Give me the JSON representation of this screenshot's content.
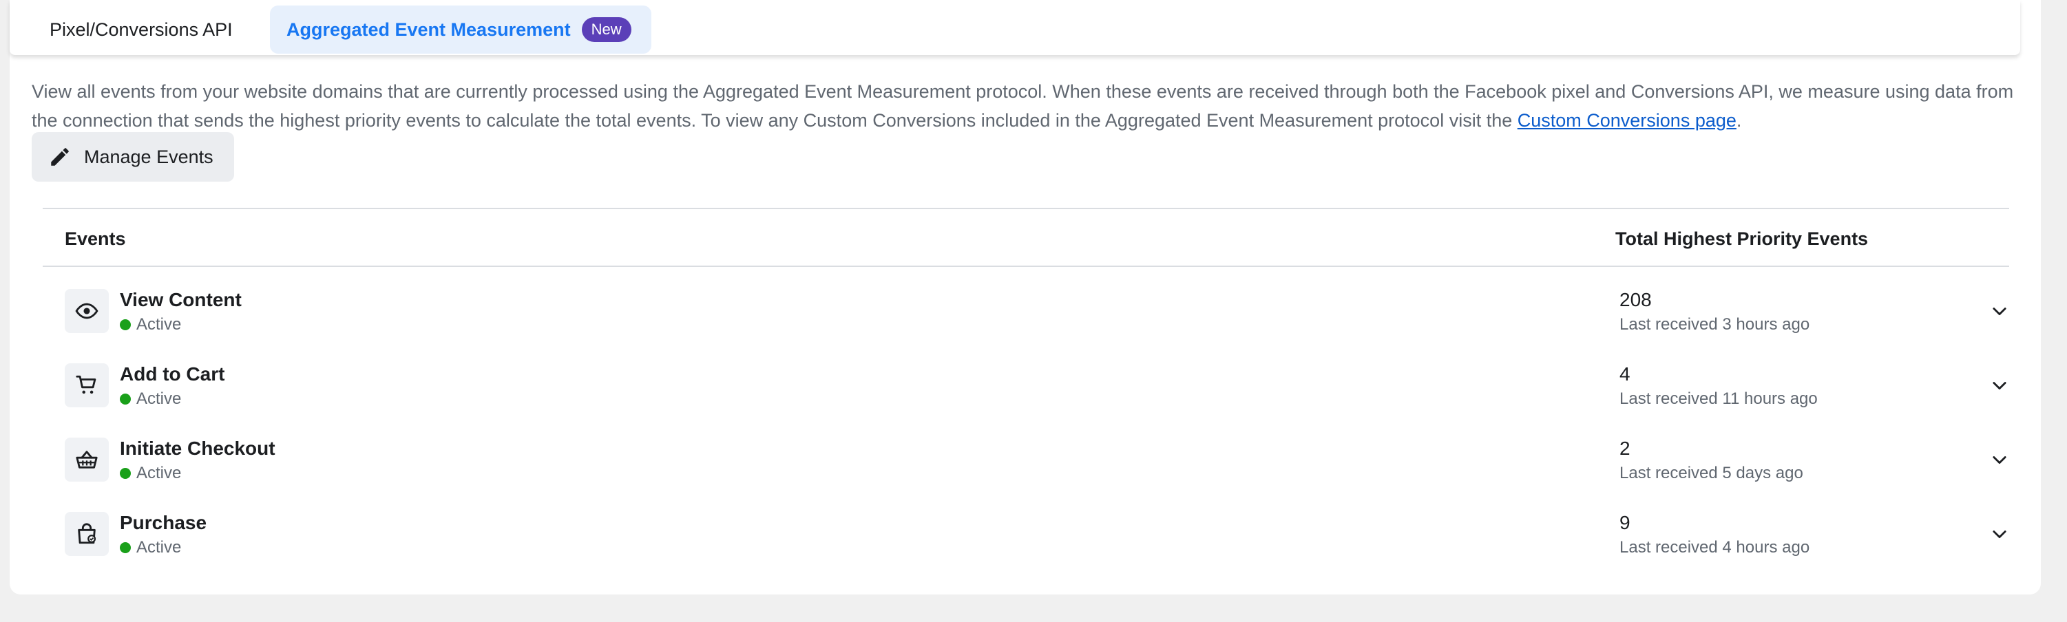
{
  "tabs": [
    {
      "label": "Pixel/Conversions API"
    },
    {
      "label": "Aggregated Event Measurement",
      "badge": "New"
    }
  ],
  "description": {
    "text": "View all events from your website domains that are currently processed using the Aggregated Event Measurement protocol. When these events are received through both the Facebook pixel and Conversions API, we measure using data from the connection that sends the highest priority events to calculate the total events. To view any Custom Conversions included in the Aggregated Event Measurement protocol visit the ",
    "link": "Custom Conversions page",
    "suffix": "."
  },
  "manage_button": {
    "label": "Manage Events",
    "icon": "pencil-icon"
  },
  "table": {
    "headers": {
      "events": "Events",
      "total": "Total Highest Priority Events"
    },
    "rows": [
      {
        "name": "View Content",
        "status": "Active",
        "count": "208",
        "last": "Last received 3 hours ago",
        "icon": "eye-icon"
      },
      {
        "name": "Add to Cart",
        "status": "Active",
        "count": "4",
        "last": "Last received 11 hours ago",
        "icon": "cart-icon"
      },
      {
        "name": "Initiate Checkout",
        "status": "Active",
        "count": "2",
        "last": "Last received 5 days ago",
        "icon": "basket-icon"
      },
      {
        "name": "Purchase",
        "status": "Active",
        "count": "9",
        "last": "Last received 4 hours ago",
        "icon": "shopping-bag-icon"
      }
    ]
  },
  "colors": {
    "accent": "#1877f2",
    "badge": "#5b3fb8",
    "active": "#1aa01a",
    "link": "#0b5ccc"
  }
}
